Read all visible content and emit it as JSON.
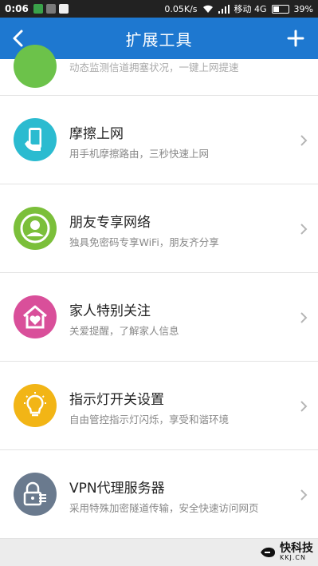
{
  "status_bar": {
    "time": "0:06",
    "speed": "0.05K/s",
    "carrier": "移动 4G",
    "battery": "39%",
    "battery_level": 0.39
  },
  "header": {
    "title": "扩展工具"
  },
  "rows": [
    {
      "title": "",
      "desc": "动态监测信道拥塞状况，一键上网提速",
      "color": "#6cc24a"
    },
    {
      "title": "摩擦上网",
      "desc": "用手机摩擦路由，三秒快速上网",
      "color": "#2bbbd0"
    },
    {
      "title": "朋友专享网络",
      "desc": "独具免密码专享WiFi，朋友齐分享",
      "color": "#7bbf3a"
    },
    {
      "title": "家人特别关注",
      "desc": "关爱提醒，了解家人信息",
      "color": "#d94f9a"
    },
    {
      "title": "指示灯开关设置",
      "desc": "自由管控指示灯闪烁，享受和谐环境",
      "color": "#f2b516"
    },
    {
      "title": "VPN代理服务器",
      "desc": "采用特殊加密隧道传输，安全快速访问网页",
      "color": "#6a7a8e"
    }
  ],
  "watermark": {
    "brand": "快科技",
    "url": "KKJ.CN"
  }
}
